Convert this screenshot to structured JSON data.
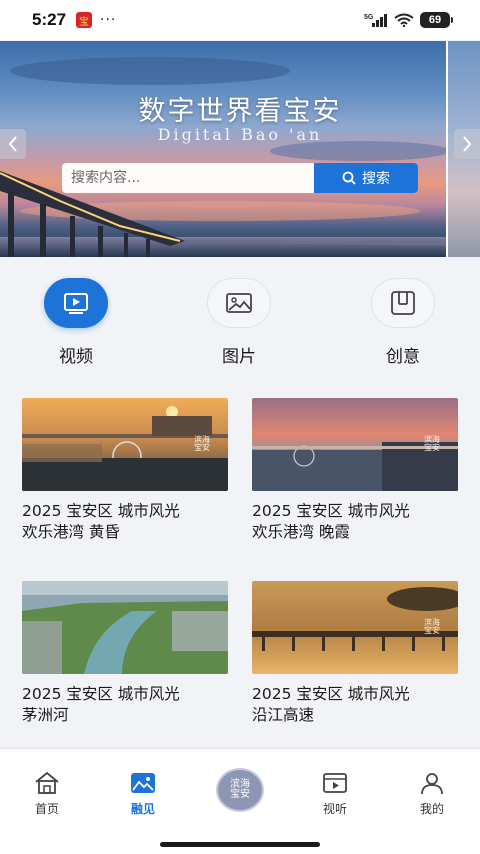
{
  "status_bar": {
    "time": "5:27",
    "dots": "···",
    "network": "5G",
    "battery": "69"
  },
  "banner": {
    "title": "数字世界看宝安",
    "subtitle": "Digital Bao 'an",
    "search_placeholder": "搜索内容...",
    "search_button": "搜索"
  },
  "categories": [
    {
      "label": "视频",
      "icon": "video-icon",
      "active": true
    },
    {
      "label": "图片",
      "icon": "image-icon",
      "active": false
    },
    {
      "label": "创意",
      "icon": "creative-icon",
      "active": false
    }
  ],
  "cards": [
    {
      "title_line1": "2025 宝安区 城市风光",
      "title_line2": "欢乐港湾 黄昏"
    },
    {
      "title_line1": "2025 宝安区 城市风光",
      "title_line2": "欢乐港湾 晚霞"
    },
    {
      "title_line1": "2025 宝安区 城市风光",
      "title_line2": "茅洲河"
    },
    {
      "title_line1": "2025 宝安区 城市风光",
      "title_line2": "沿江高速"
    }
  ],
  "bottom_nav": [
    {
      "label": "首页",
      "icon": "home-icon",
      "active": false
    },
    {
      "label": "融见",
      "icon": "landscape-icon",
      "active": true
    },
    {
      "label": "视听",
      "icon": "media-icon",
      "active": false
    },
    {
      "label": "我的",
      "icon": "user-icon",
      "active": false
    }
  ],
  "center_button": {
    "line1": "滨海",
    "line2": "宝安"
  },
  "colors": {
    "accent": "#1e73d8",
    "background": "#f1f3f7"
  }
}
